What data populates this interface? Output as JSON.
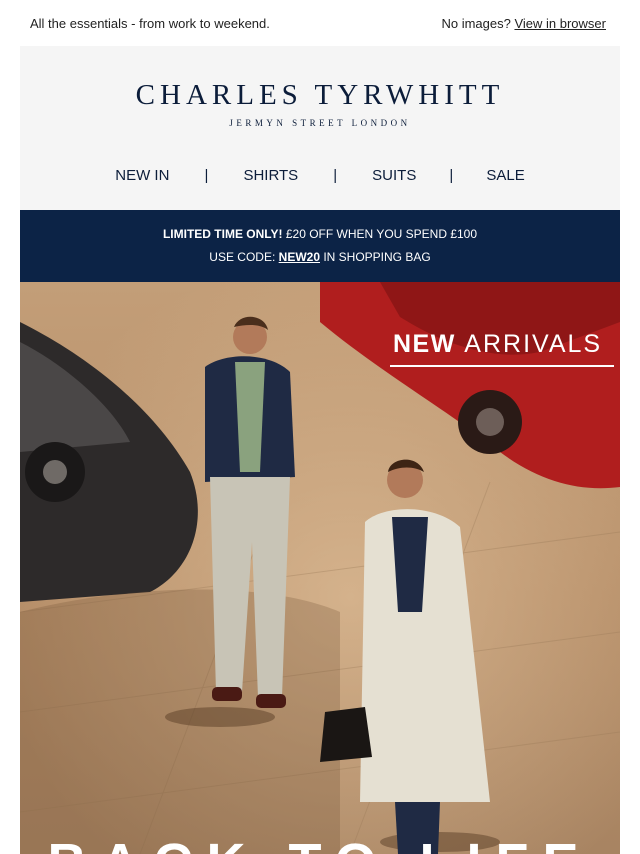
{
  "preheader": {
    "left_text": "All the essentials - from work to weekend.",
    "right_prefix": "No images?",
    "right_link": "View in browser"
  },
  "brand": {
    "name": "CHARLES TYRWHITT",
    "tagline": "JERMYN STREET LONDON"
  },
  "nav": {
    "items": [
      "NEW IN",
      "SHIRTS",
      "SUITS",
      "SALE"
    ],
    "separator": "|"
  },
  "promo": {
    "line1_bold": "LIMITED TIME ONLY!",
    "line1_rest": " £20 OFF WHEN YOU SPEND £100",
    "line2_prefix": "USE CODE: ",
    "code": "NEW20",
    "line2_suffix": " IN SHOPPING BAG"
  },
  "hero": {
    "title_bold": "NEW",
    "title_light": "ARRIVALS",
    "bottom_text": "BACK TO LIFE"
  },
  "colors": {
    "navy": "#0c2346",
    "header_bg": "#f5f5f5",
    "pavement": "#b08a66"
  }
}
